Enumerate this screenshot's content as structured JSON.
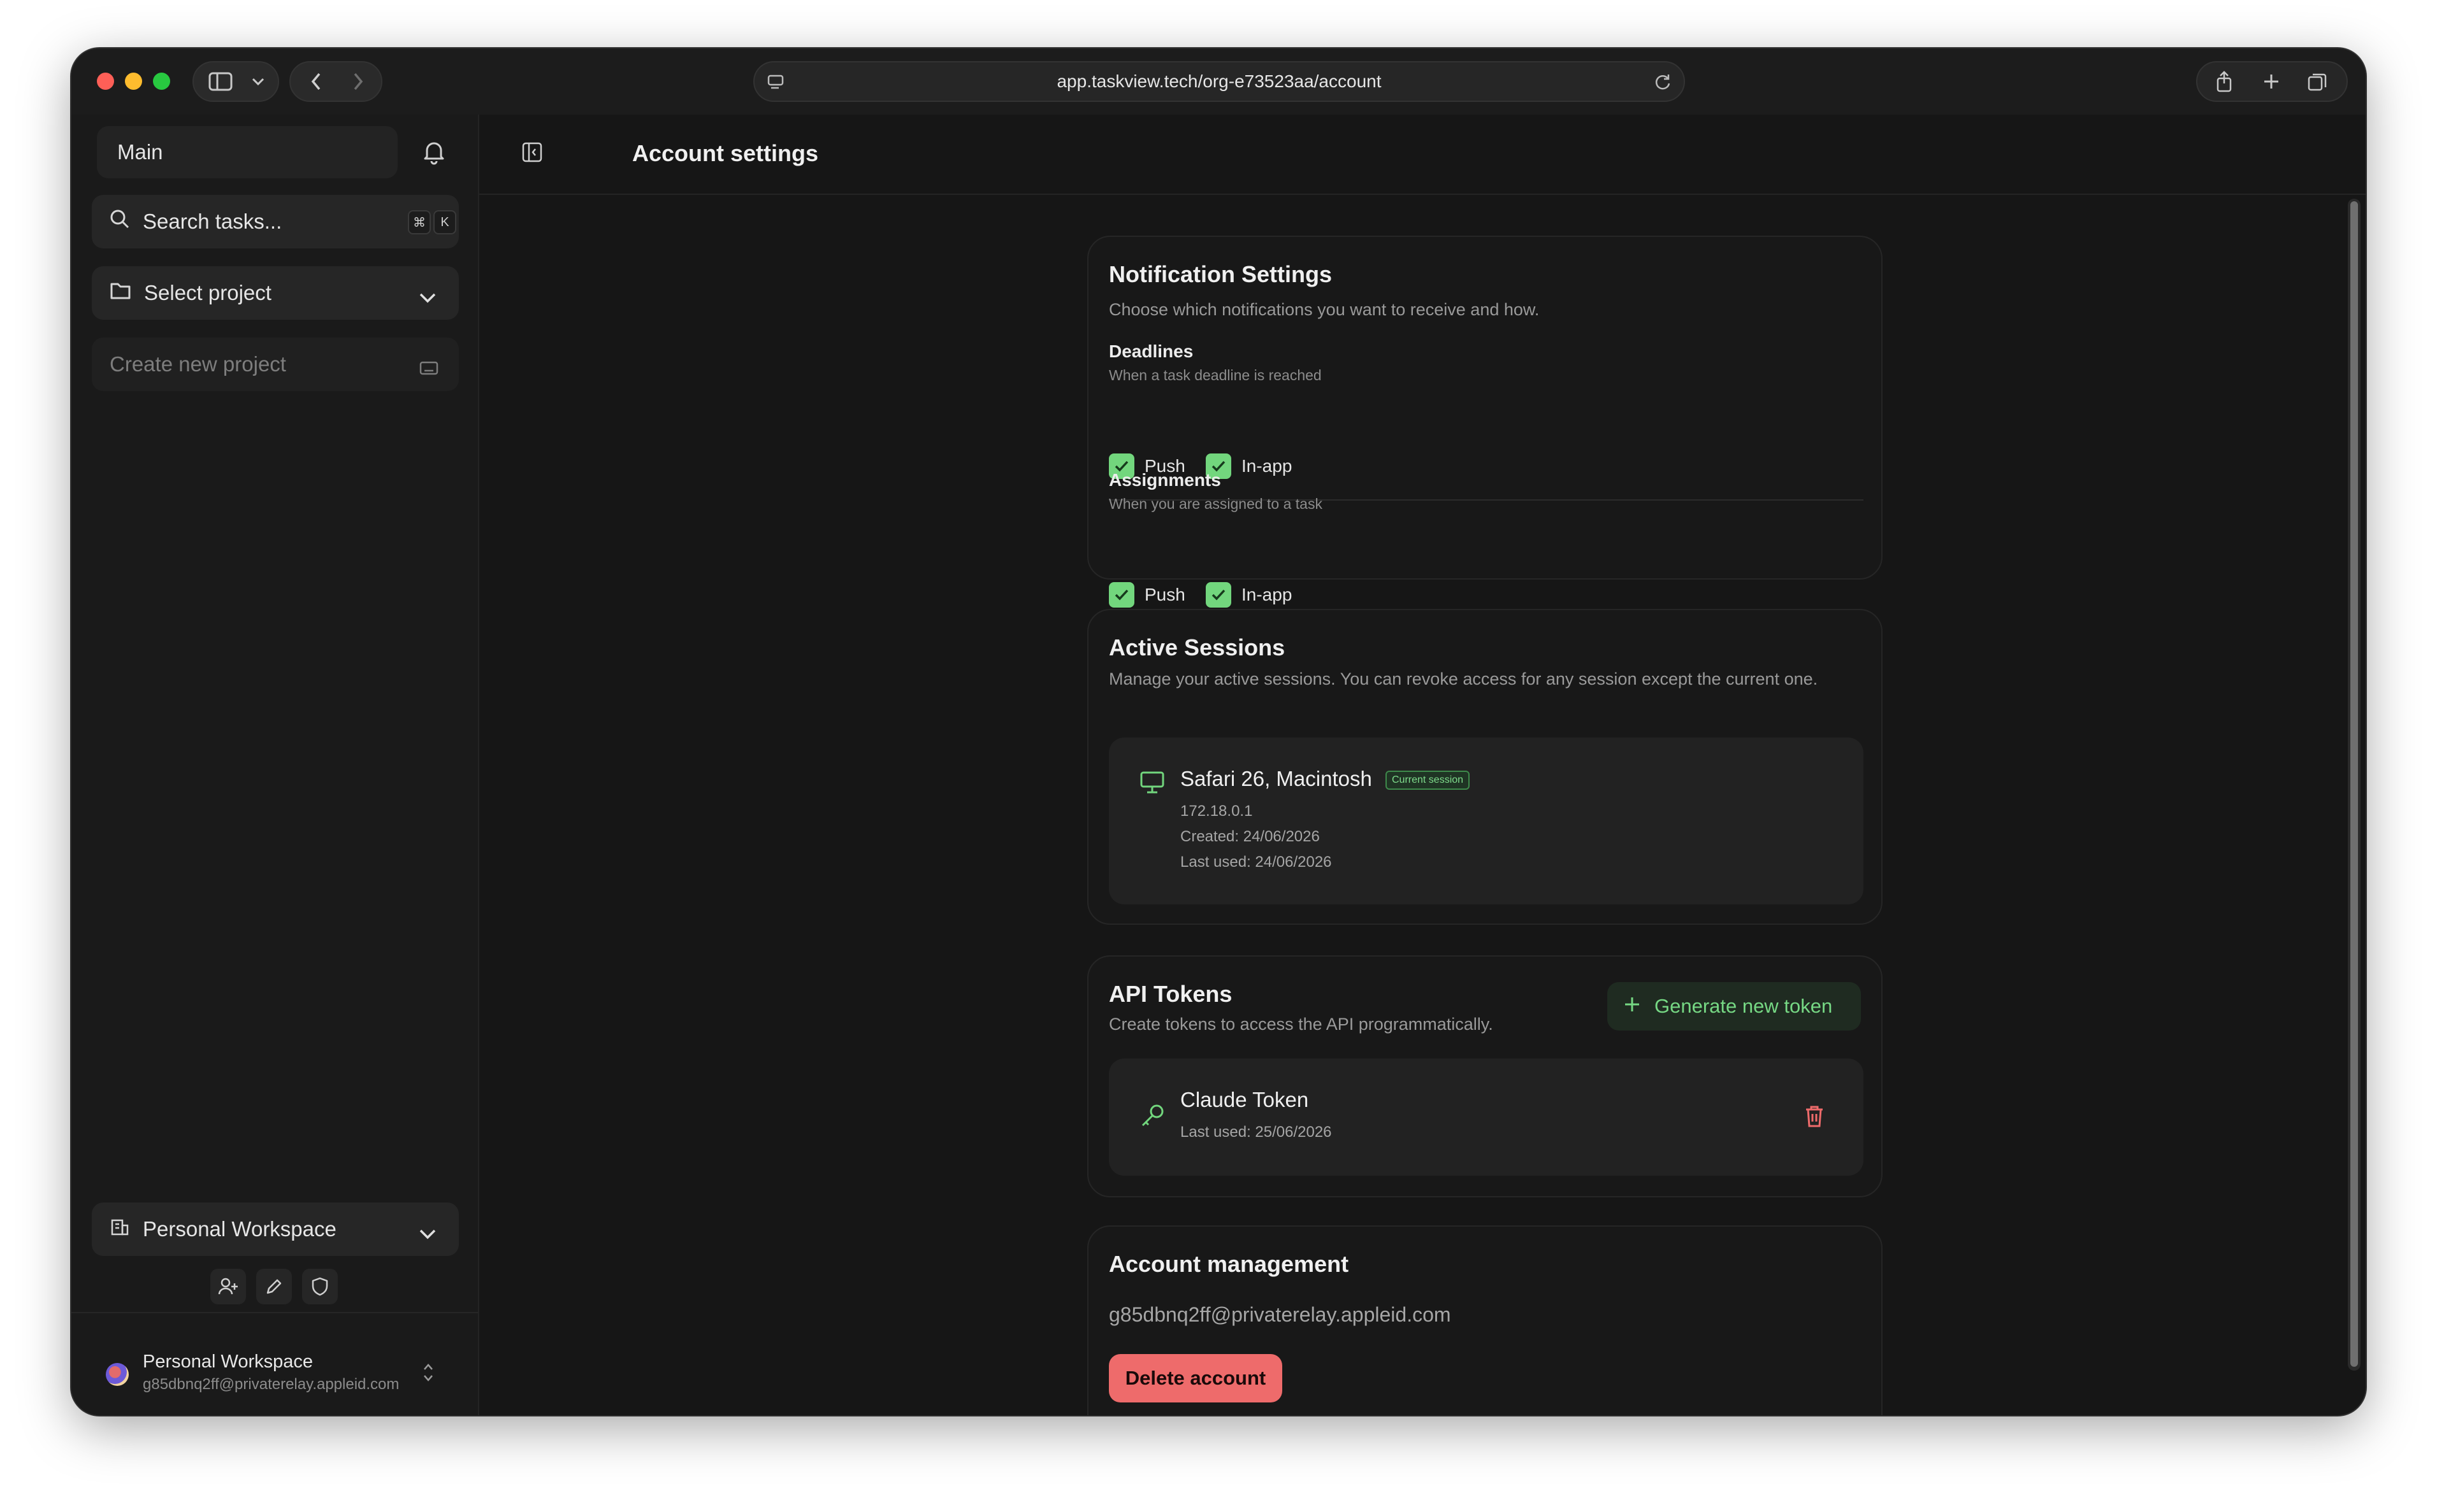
{
  "browser": {
    "url": "app.taskview.tech/org-e73523aa/account"
  },
  "sidebar": {
    "main_label": "Main",
    "search_placeholder": "Search tasks...",
    "search_shortcut": [
      "⌘",
      "K"
    ],
    "select_project_label": "Select project",
    "create_project_placeholder": "Create new project",
    "workspace_label": "Personal Workspace",
    "user": {
      "name": "Personal Workspace",
      "email": "g85dbnq2ff@privaterelay.appleid.com"
    }
  },
  "header": {
    "title": "Account settings"
  },
  "notifications": {
    "title": "Notification Settings",
    "description": "Choose which notifications you want to receive and how.",
    "groups": [
      {
        "title": "Deadlines",
        "description": "When a task deadline is reached",
        "options": [
          {
            "label": "Push",
            "checked": true
          },
          {
            "label": "In-app",
            "checked": true
          }
        ]
      },
      {
        "title": "Assignments",
        "description": "When you are assigned to a task",
        "options": [
          {
            "label": "Push",
            "checked": true
          },
          {
            "label": "In-app",
            "checked": true
          }
        ]
      }
    ]
  },
  "sessions": {
    "title": "Active Sessions",
    "description": "Manage your active sessions. You can revoke access for any session except the current one.",
    "items": [
      {
        "name": "Safari 26, Macintosh",
        "badge": "Current session",
        "ip": "172.18.0.1",
        "created": "Created: 24/06/2026",
        "last_used": "Last used: 24/06/2026"
      }
    ]
  },
  "tokens": {
    "title": "API Tokens",
    "description": "Create tokens to access the API programmatically.",
    "generate_label": "Generate new token",
    "items": [
      {
        "name": "Claude Token",
        "last_used": "Last used: 25/06/2026"
      }
    ]
  },
  "account": {
    "title": "Account management",
    "email": "g85dbnq2ff@privaterelay.appleid.com",
    "delete_label": "Delete account"
  },
  "colors": {
    "accent_green": "#72d67d",
    "danger_red": "#ee6b6b",
    "background": "#161616"
  }
}
